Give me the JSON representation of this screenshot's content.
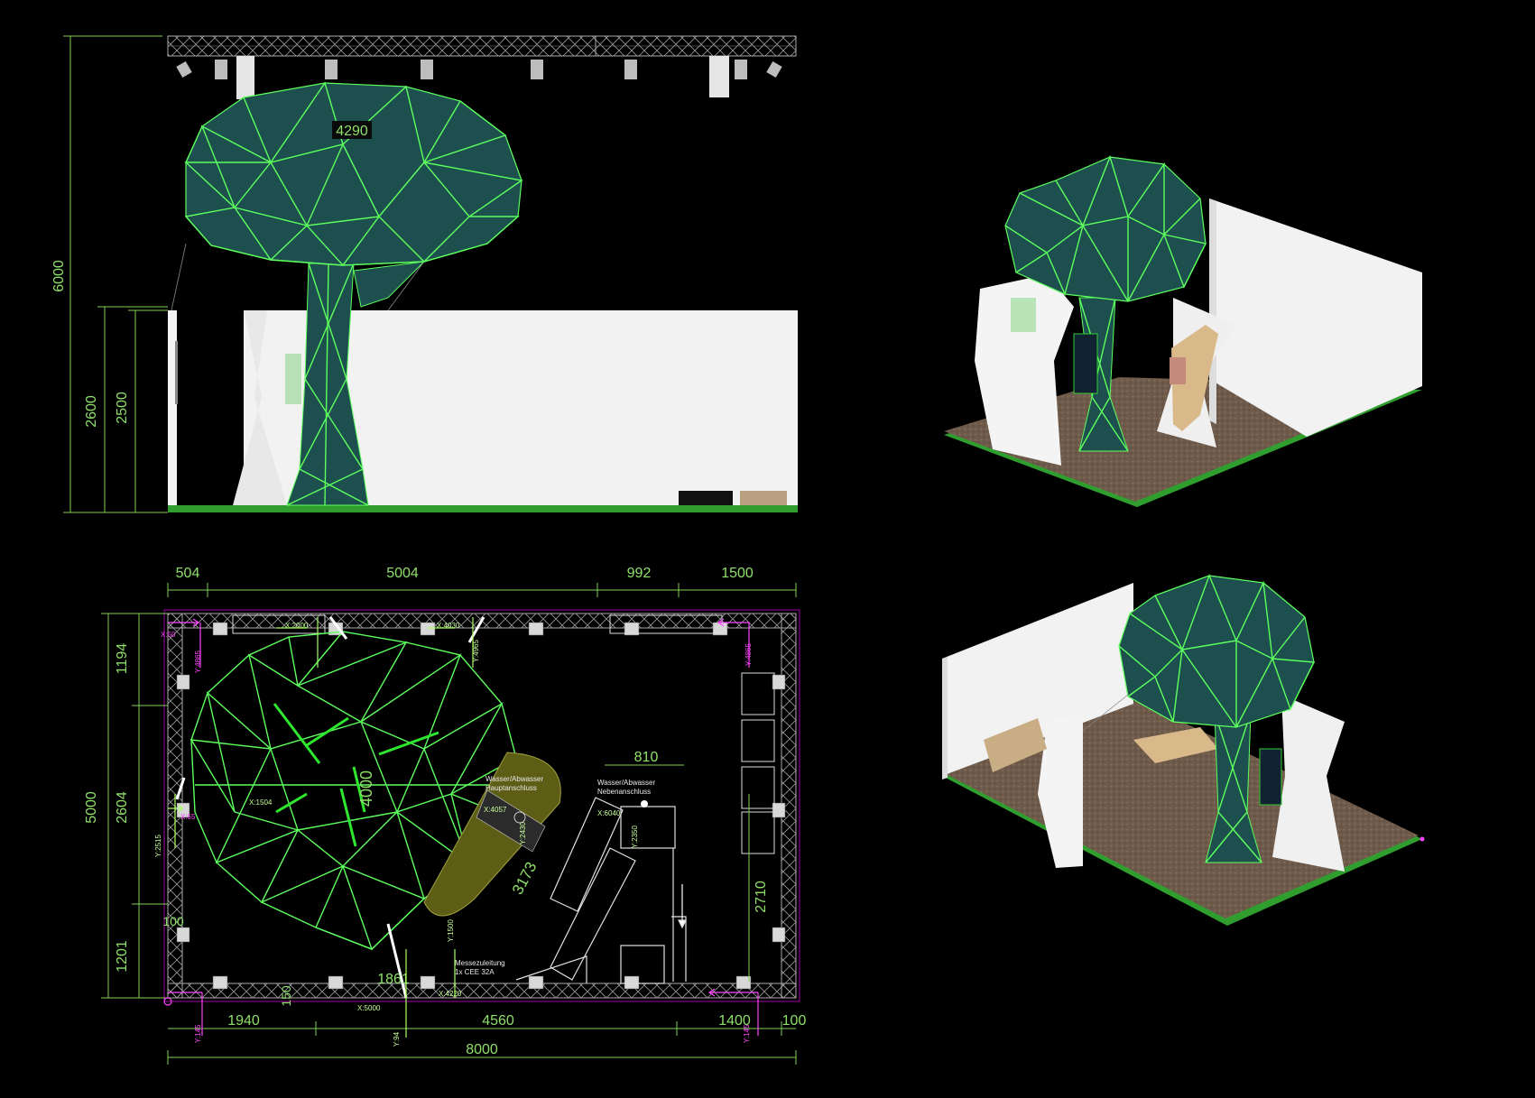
{
  "elevation": {
    "canopy_label": "4290",
    "height_total": "6000",
    "height_wall_outer": "2600",
    "height_wall_inner": "2500"
  },
  "plan": {
    "top_dims": [
      "504",
      "5004",
      "992",
      "1500"
    ],
    "left_dims": [
      "1194",
      "2604",
      "1201"
    ],
    "left_total": "5000",
    "bottom_dims": [
      "1940",
      "150",
      "4560",
      "1400",
      "100"
    ],
    "bottom_total": "8000",
    "inner": {
      "canopy_dia": "4000",
      "counter_len": "3173",
      "kitchen_w": "810",
      "right_dim": "2710",
      "tree_base": "1861",
      "left_small": "100"
    },
    "notes": {
      "water_1a": "Wasser/Abwasser",
      "water_1b": "Hauptanschluss",
      "water_2a": "Wasser/Abwasser",
      "water_2b": "Nebenanschluss",
      "power_a": "Messezuleitung",
      "power_b": "1x CEE 32A"
    },
    "coords": {
      "c1": "X:2000",
      "c2": "X:4030",
      "c3": "X:50",
      "c4": "Y:4865",
      "c5": "Y:4965",
      "c6": "Y:4865",
      "c7": "X:55",
      "c8": "Y:2515",
      "c9": "X:1504",
      "c10": "X:4057",
      "c11": "Y:2430",
      "c12": "X:6040",
      "c13": "Y:2350",
      "c14": "Y:1500",
      "c15": "X:4220",
      "c16": "X:5000",
      "c17": "Y:145",
      "c18": "Y:94",
      "c19": "Y:145"
    }
  },
  "colors": {
    "background": "#000000",
    "canopy_fill": "#1d4f4f",
    "mesh_line": "#5dff5d",
    "dim_text": "#8fe06a",
    "wall": "#f2f2f2",
    "floor_carpet": "#6e5a4a",
    "floor_edge": "#2f9e2f",
    "marker": "#ff44ff"
  }
}
